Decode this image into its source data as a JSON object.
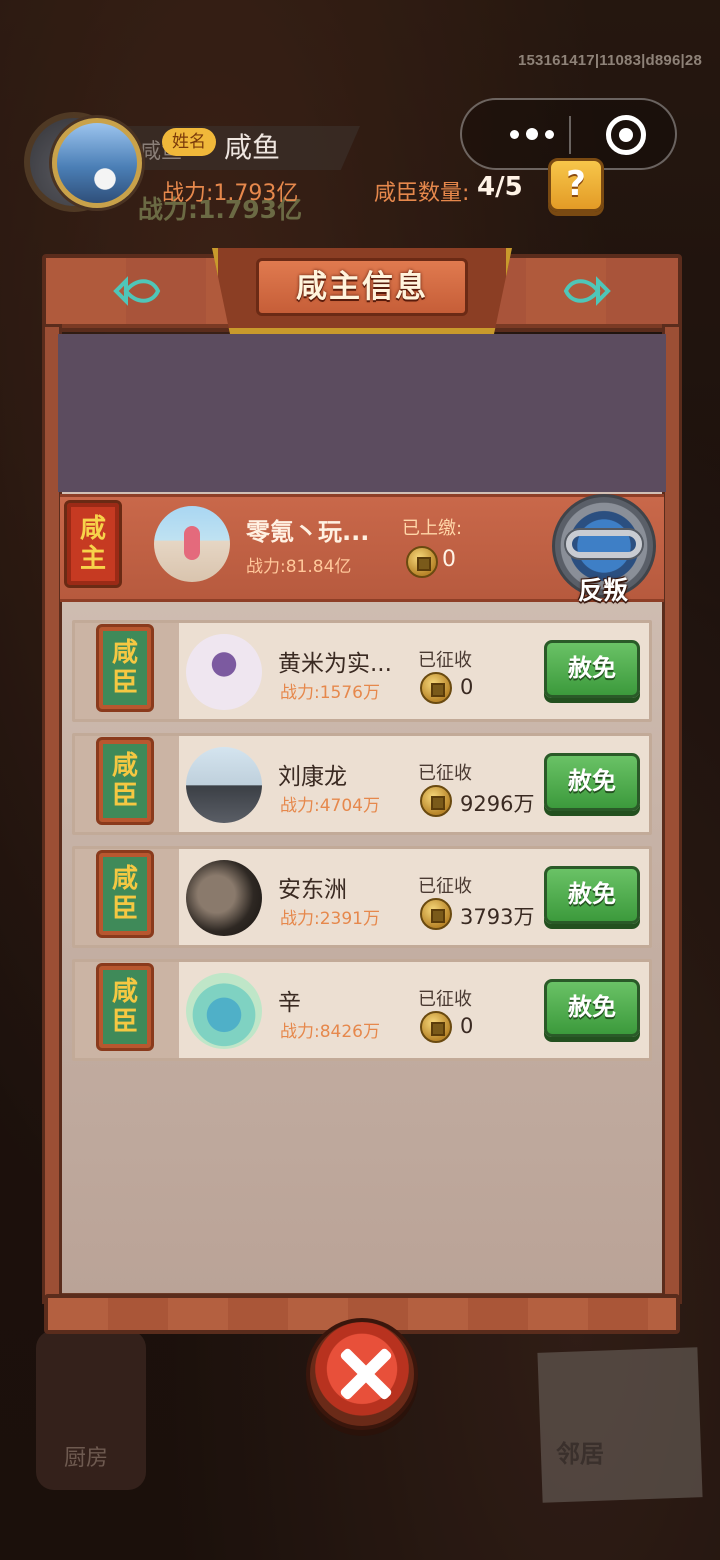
{
  "system": {
    "debug_id": "153161417|11083|d896|28"
  },
  "background": {
    "player_name": "咸鱼",
    "player_power": "战力:1.793亿",
    "kitchen_label": "厨房",
    "neighbor_label": "邻居"
  },
  "dialog": {
    "title": "咸主信息",
    "lord": {
      "name_tag": "姓名",
      "name": "咸鱼",
      "power": "战力:1.793亿",
      "minister_count_label": "咸臣数量:",
      "minister_count_value": "4/5",
      "help_label": "?"
    },
    "master": {
      "badge_line1": "咸",
      "badge_line2": "主",
      "name": "零氪丶玩...",
      "power": "战力:81.84亿",
      "paid_label": "已上缴:",
      "paid_value": "0",
      "rebel_label": "反叛"
    },
    "ministers": [
      {
        "badge_line1": "咸",
        "badge_line2": "臣",
        "name": "黄米为实...",
        "power": "战力:1576万",
        "collected_label": "已征收",
        "collected_value": "0",
        "action": "赦免"
      },
      {
        "badge_line1": "咸",
        "badge_line2": "臣",
        "name": "刘康龙",
        "power": "战力:4704万",
        "collected_label": "已征收",
        "collected_value": "9296万",
        "action": "赦免"
      },
      {
        "badge_line1": "咸",
        "badge_line2": "臣",
        "name": "安东洲",
        "power": "战力:2391万",
        "collected_label": "已征收",
        "collected_value": "3793万",
        "action": "赦免"
      },
      {
        "badge_line1": "咸",
        "badge_line2": "臣",
        "name": "辛",
        "power": "战力:8426万",
        "collected_label": "已征收",
        "collected_value": "0",
        "action": "赦免"
      }
    ]
  },
  "colors": {
    "accent_orange": "#e6884c",
    "button_green": "#3c9a3c",
    "title_red": "#c65e38",
    "lord_panel": "#5c4c5f"
  }
}
